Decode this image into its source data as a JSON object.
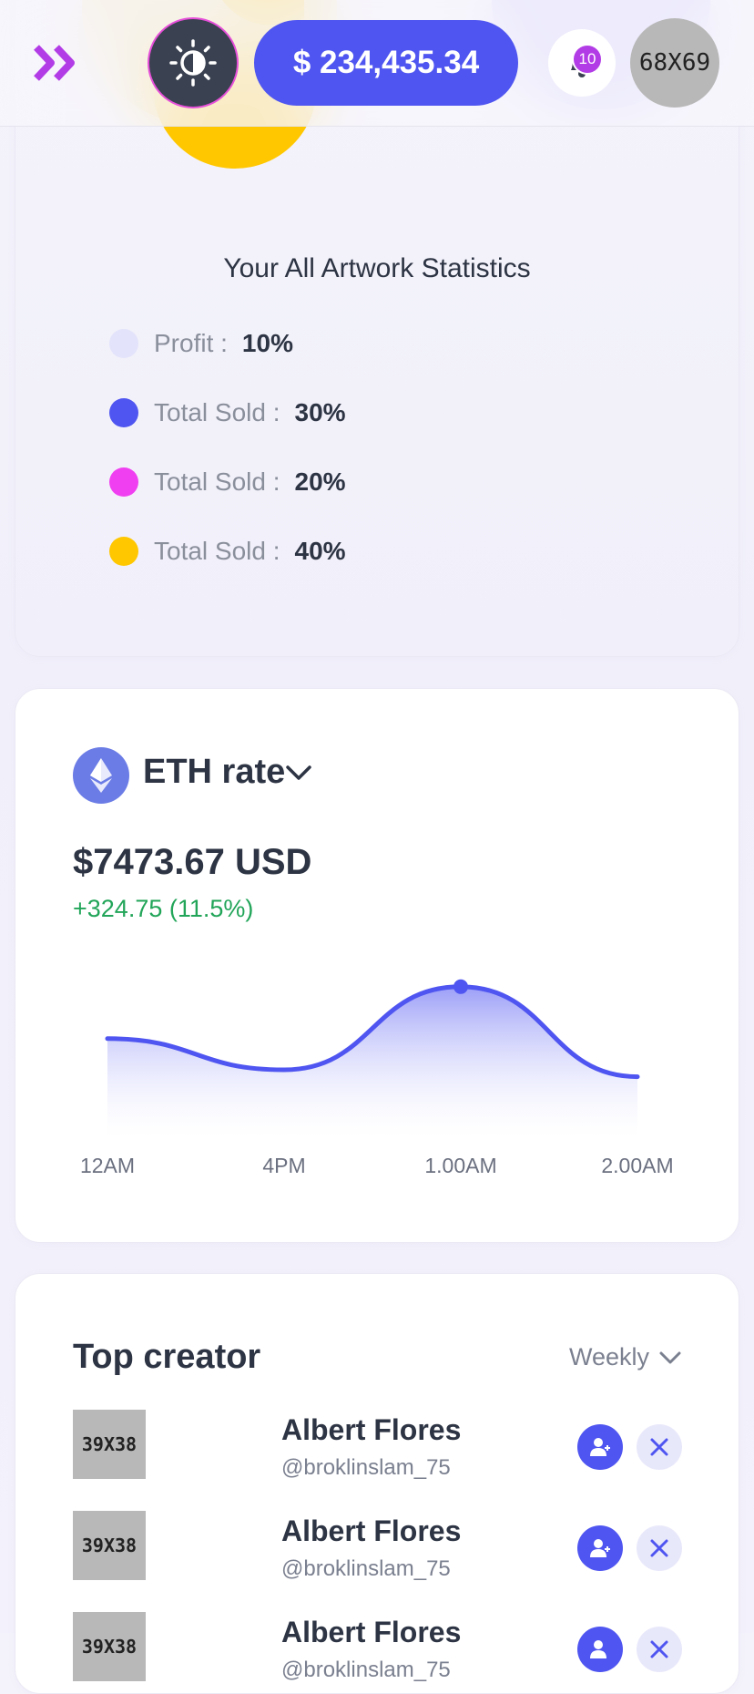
{
  "header": {
    "menu_icon": "double-chevron-right-icon",
    "theme_icon": "sun-moon-icon",
    "balance": "$ 234,435.34",
    "notification_count": "10",
    "avatar_placeholder": "68X69"
  },
  "stats": {
    "title": "Your All Artwork Statistics",
    "legend": [
      {
        "label": "Profit :",
        "value": "10%",
        "color": "#e3e3fb"
      },
      {
        "label": "Total Sold :",
        "value": "30%",
        "color": "#4f55f0"
      },
      {
        "label": "Total Sold :",
        "value": "20%",
        "color": "#f03ff0"
      },
      {
        "label": "Total Sold :",
        "value": "40%",
        "color": "#ffc700"
      }
    ]
  },
  "eth": {
    "title": "ETH rate",
    "price": "$7473.67 USD",
    "change": "+324.75 (11.5%)",
    "change_color": "#22a559"
  },
  "chart_data": {
    "type": "area",
    "x": [
      "12AM",
      "4PM",
      "1.00AM",
      "2.00AM"
    ],
    "series": [
      {
        "values": [
          58,
          40,
          88,
          36
        ]
      }
    ],
    "highlight_index": 2,
    "ylim": [
      0,
      100
    ],
    "grid": false,
    "line_color": "#4f55f0"
  },
  "top_creator": {
    "title": "Top creator",
    "filter": "Weekly",
    "creators": [
      {
        "thumb": "39X38",
        "name": "Albert Flores",
        "handle": "@broklinslam_75"
      },
      {
        "thumb": "39X38",
        "name": "Albert Flores",
        "handle": "@broklinslam_75"
      },
      {
        "thumb": "39X38",
        "name": "Albert Flores",
        "handle": "@broklinslam_75"
      }
    ]
  }
}
